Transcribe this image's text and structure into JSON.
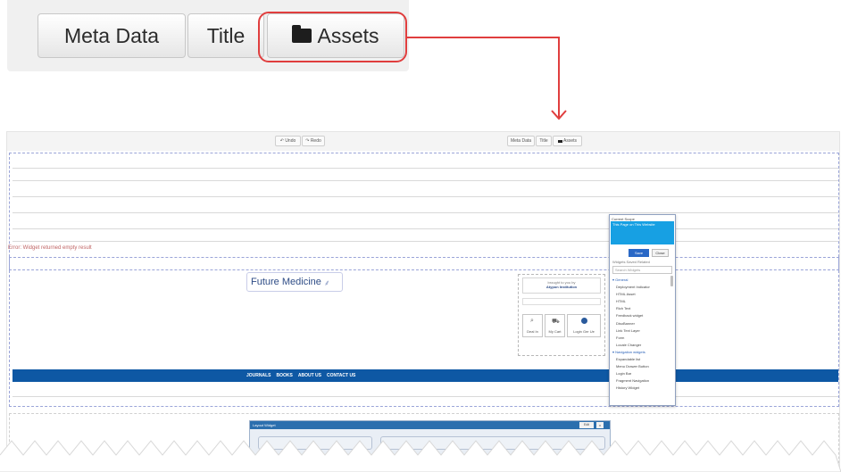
{
  "zoom_toolbar": {
    "meta_data_label": "Meta Data",
    "title_label": "Title",
    "assets_label": "Assets",
    "assets_icon": "folder-icon",
    "highlight_color": "#e03e3e"
  },
  "screenshot": {
    "toolbar": {
      "undo_label": "Undo",
      "redo_label": "Redo",
      "meta_data_label": "Meta Data",
      "title_label": "Title",
      "assets_label": "Assets"
    },
    "error_text": "Error: Widget returned empty result",
    "logo_text": "Future Medicine",
    "institution": {
      "line1": "brought to you by",
      "line2": "Atypon Institution",
      "buttons": [
        "Deal In",
        "My Cart",
        "Login Ger Ue"
      ]
    },
    "nav_items": [
      "JOURNALS",
      "BOOKS",
      "ABOUT US",
      "CONTACT US"
    ],
    "nav_color": "#0e58a4",
    "widget_picker": {
      "scope_label": "Current Scope",
      "scope_value": "This Page on This Website",
      "save_label": "Save",
      "close_label": "Close",
      "tabs": "Widgets  Saved  Related",
      "search_placeholder": "Search Widgets",
      "items": [
        {
          "label": "General",
          "category": true
        },
        {
          "label": "Deployment Indicator",
          "category": false
        },
        {
          "label": "HTML Asset",
          "category": false
        },
        {
          "label": "HTML",
          "category": false
        },
        {
          "label": "Rich Text",
          "category": false
        },
        {
          "label": "Feedback widget",
          "category": false
        },
        {
          "label": "DisoBanner",
          "category": false
        },
        {
          "label": "Link Text Layer",
          "category": false
        },
        {
          "label": "Form",
          "category": false
        },
        {
          "label": "Locale Changer",
          "category": false
        },
        {
          "label": "Navigation widgets",
          "category": true
        },
        {
          "label": "Expandable list",
          "category": false
        },
        {
          "label": "Menu Drawer Button",
          "category": false
        },
        {
          "label": "Login Bar",
          "category": false
        },
        {
          "label": "Fragment Navigation",
          "category": false
        },
        {
          "label": "History Widget",
          "category": false
        }
      ],
      "accent_color": "#17a0e3"
    },
    "layout_widget": {
      "title": "Layout Widget",
      "edit_label": "Edit",
      "close_label": "x"
    }
  }
}
